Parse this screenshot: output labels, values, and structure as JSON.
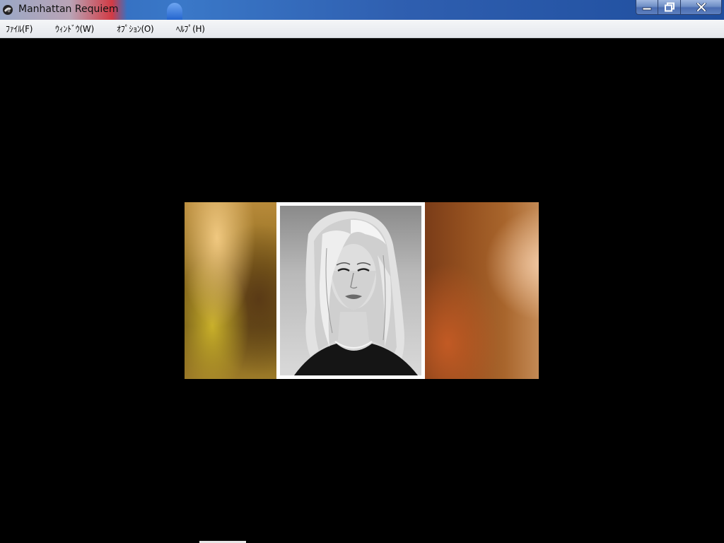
{
  "window": {
    "title": "Manhattan Requiem",
    "app_icon": "app-icon",
    "controls": {
      "minimize_icon": "minimize-icon",
      "maximize_icon": "restore-icon",
      "close_icon": "close-icon"
    }
  },
  "menu": {
    "items": [
      {
        "label": "ﾌｧｲﾙ(F)"
      },
      {
        "label": "ｳｨﾝﾄﾞｳ(W)"
      },
      {
        "label": "ｵﾌﾟｼｮﾝ(O)"
      },
      {
        "label": "ﾍﾙﾌﾟ(H)"
      }
    ]
  },
  "scene": {
    "portrait": "woman-portrait",
    "frame_color": "#ffffff",
    "background_color": "#000000"
  },
  "colors": {
    "titlebar": "#2f5fb0",
    "menubar": "#eceef2",
    "client": "#000000"
  }
}
